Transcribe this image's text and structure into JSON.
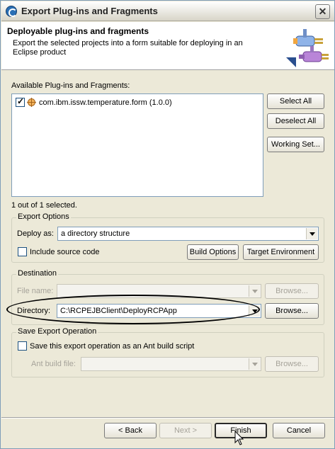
{
  "window": {
    "title": "Export Plug-ins and Fragments",
    "close_glyph": "✕"
  },
  "banner": {
    "heading": "Deployable plug-ins and fragments",
    "description": "Export the selected projects into a form suitable for deploying in an Eclipse product"
  },
  "available": {
    "label": "Available Plug-ins and Fragments:",
    "items": [
      {
        "label": "com.ibm.issw.temperature.form (1.0.0)",
        "checked": true
      }
    ],
    "selection_status": "1 out of 1 selected.",
    "buttons": {
      "select_all": "Select All",
      "deselect_all": "Deselect All",
      "working_set": "Working Set..."
    }
  },
  "export_options": {
    "legend": "Export Options",
    "deploy_as_label": "Deploy as:",
    "deploy_as_value": "a directory structure",
    "include_source_label": "Include source code",
    "include_source_checked": false,
    "build_options": "Build Options",
    "target_environment": "Target Environment"
  },
  "destination": {
    "legend": "Destination",
    "file_name_label": "File name:",
    "file_name_value": "",
    "browse_file": "Browse...",
    "directory_label": "Directory:",
    "directory_value": "C:\\RCPEJBClient\\DeployRCPApp",
    "browse_directory": "Browse..."
  },
  "save_export": {
    "legend": "Save Export Operation",
    "save_label": "Save this export operation as an Ant build script",
    "save_checked": false,
    "ant_file_label": "Ant build file:",
    "ant_file_value": "",
    "browse": "Browse..."
  },
  "footer": {
    "back": "< Back",
    "next": "Next >",
    "finish": "Finish",
    "cancel": "Cancel"
  },
  "icons": {
    "app": "eclipse-icon",
    "wizard": "plug-in-export-wizard-icon",
    "plugin": "plugin-icon",
    "cursor": "mouse-pointer-icon"
  }
}
